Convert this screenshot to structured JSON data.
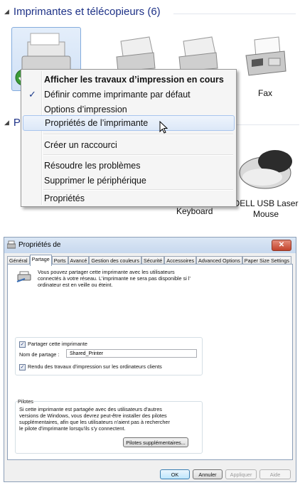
{
  "explorer": {
    "group1": {
      "label": "Imprimantes et télécopieurs (6)"
    },
    "group2": {
      "label": "P"
    },
    "devices": {
      "fax": "Fax",
      "keyboard": "Keyboard",
      "mouse_line1": "DELL USB Laser",
      "mouse_line2": "Mouse"
    },
    "context_menu": {
      "items": [
        "Afficher les travaux d’impression en cours",
        "Définir comme imprimante par défaut",
        "Options d’impression",
        "Propriétés de l’imprimante",
        "Créer un raccourci",
        "Résoudre les problèmes",
        "Supprimer le périphérique",
        "Propriétés"
      ],
      "check": "✓"
    }
  },
  "dialog": {
    "title": "Propriétés de",
    "close": "✕",
    "tabs": [
      "Général",
      "Partage",
      "Ports",
      "Avancé",
      "Gestion des couleurs",
      "Sécurité",
      "Accessoires",
      "Advanced Options",
      "Paper Size Settings"
    ],
    "active_tab": "Partage",
    "info_line1": "Vous pouvez partager cette imprimante avec les utilisateurs",
    "info_line2": "connectés à votre réseau. L'imprimante ne sera pas disponible si l'",
    "info_line3": "ordinateur est en veille ou éteint.",
    "share_checkbox": "Partager cette imprimante",
    "share_name_label": "Nom de partage :",
    "share_name_value": "Shared_Printer",
    "render_checkbox": "Rendu des travaux d'impression sur les ordinateurs clients",
    "drivers_title": "Pilotes",
    "drivers_line1": "Si cette imprimante est partagée avec des utilisateurs d'autres",
    "drivers_line2": "versions de Windows, vous devrez peut-être installer des pilotes",
    "drivers_line3": "supplémentaires, afin que les utilisateurs n'aient pas à rechercher",
    "drivers_line4": "le pilote d'imprimante lorsqu'ils s'y connectent.",
    "drivers_button": "Pilotes supplémentaires...",
    "buttons": {
      "ok": "OK",
      "cancel": "Annuler",
      "apply": "Appliquer",
      "help": "Aide"
    },
    "checkmark": "✓"
  }
}
